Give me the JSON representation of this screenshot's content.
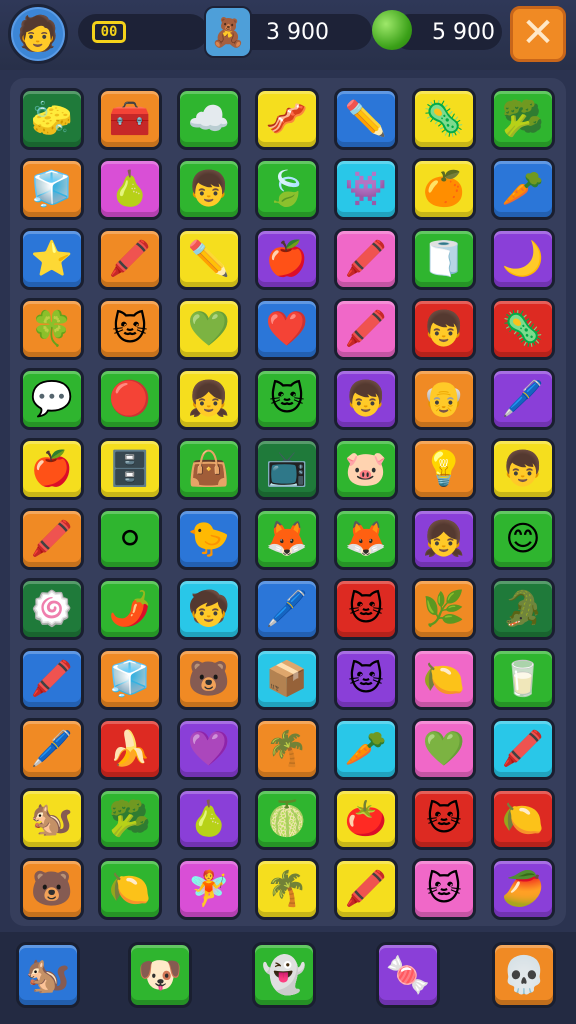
{
  "hud": {
    "avatar_icon": "player-avatar-boy",
    "level_text": "00",
    "coins": "3 900",
    "gems": "5 900",
    "close_label": "✕"
  },
  "colors": {
    "green": "#2fb52f",
    "orange": "#f08a24",
    "yellow": "#f5de1e",
    "blue": "#2b76d8",
    "pink": "#f068c8",
    "purple": "#8a3fd8",
    "red": "#dd2a22",
    "cyan": "#29c7e8",
    "darkgreen": "#1f7a3a",
    "lime": "#52c234",
    "magenta": "#d94fd6"
  },
  "board": [
    [
      {
        "c": "darkgreen",
        "g": "🧽"
      },
      {
        "c": "orange",
        "g": "🧰"
      },
      {
        "c": "green",
        "g": "☁️"
      },
      {
        "c": "yellow",
        "g": "🥓"
      },
      {
        "c": "blue",
        "g": "✏️"
      },
      {
        "c": "yellow",
        "g": "🦠"
      },
      {
        "c": "green",
        "g": "🥦"
      }
    ],
    [
      {
        "c": "orange",
        "g": "🧊"
      },
      {
        "c": "magenta",
        "g": "🍐"
      },
      {
        "c": "green",
        "g": "👦"
      },
      {
        "c": "green",
        "g": "🍃"
      },
      {
        "c": "cyan",
        "g": "👾"
      },
      {
        "c": "yellow",
        "g": "🍊"
      },
      {
        "c": "blue",
        "g": "🥕"
      }
    ],
    [
      {
        "c": "blue",
        "g": "⭐"
      },
      {
        "c": "orange",
        "g": "🖍️"
      },
      {
        "c": "yellow",
        "g": "✏️"
      },
      {
        "c": "purple",
        "g": "🍎"
      },
      {
        "c": "pink",
        "g": "🖍️"
      },
      {
        "c": "green",
        "g": "🧻"
      },
      {
        "c": "purple",
        "g": "🌙"
      }
    ],
    [
      {
        "c": "orange",
        "g": "🍀"
      },
      {
        "c": "orange",
        "g": "🐱"
      },
      {
        "c": "yellow",
        "g": "💚"
      },
      {
        "c": "blue",
        "g": "❤️"
      },
      {
        "c": "pink",
        "g": "🖍️"
      },
      {
        "c": "red",
        "g": "👦"
      },
      {
        "c": "red",
        "g": "🦠"
      }
    ],
    [
      {
        "c": "green",
        "g": "💬"
      },
      {
        "c": "green",
        "g": "🔴"
      },
      {
        "c": "yellow",
        "g": "👧"
      },
      {
        "c": "green",
        "g": "🐱"
      },
      {
        "c": "purple",
        "g": "👦"
      },
      {
        "c": "orange",
        "g": "👴"
      },
      {
        "c": "purple",
        "g": "🖊️"
      }
    ],
    [
      {
        "c": "yellow",
        "g": "🍎"
      },
      {
        "c": "yellow",
        "g": "🗄️"
      },
      {
        "c": "green",
        "g": "👜"
      },
      {
        "c": "darkgreen",
        "g": "📺"
      },
      {
        "c": "green",
        "g": "🐷"
      },
      {
        "c": "orange",
        "g": "💡"
      },
      {
        "c": "yellow",
        "g": "👦"
      }
    ],
    [
      {
        "c": "orange",
        "g": "🖍️"
      },
      {
        "c": "green",
        "g": "⚪"
      },
      {
        "c": "blue",
        "g": "🐤"
      },
      {
        "c": "green",
        "g": "🦊"
      },
      {
        "c": "green",
        "g": "🦊"
      },
      {
        "c": "purple",
        "g": "👧"
      },
      {
        "c": "green",
        "g": "😊"
      }
    ],
    [
      {
        "c": "darkgreen",
        "g": "🍥"
      },
      {
        "c": "green",
        "g": "🌶️"
      },
      {
        "c": "cyan",
        "g": "🧒"
      },
      {
        "c": "blue",
        "g": "🖊️"
      },
      {
        "c": "red",
        "g": "🐱"
      },
      {
        "c": "orange",
        "g": "🌿"
      },
      {
        "c": "darkgreen",
        "g": "🐊"
      }
    ],
    [
      {
        "c": "blue",
        "g": "🖍️"
      },
      {
        "c": "orange",
        "g": "🧊"
      },
      {
        "c": "orange",
        "g": "🐻"
      },
      {
        "c": "cyan",
        "g": "📦"
      },
      {
        "c": "purple",
        "g": "🐱"
      },
      {
        "c": "pink",
        "g": "🍋"
      },
      {
        "c": "green",
        "g": "🥛"
      }
    ],
    [
      {
        "c": "orange",
        "g": "🖊️"
      },
      {
        "c": "red",
        "g": "🍌"
      },
      {
        "c": "purple",
        "g": "💜"
      },
      {
        "c": "orange",
        "g": "🌴"
      },
      {
        "c": "cyan",
        "g": "🥕"
      },
      {
        "c": "pink",
        "g": "💚"
      },
      {
        "c": "cyan",
        "g": "🖍️"
      }
    ],
    [
      {
        "c": "yellow",
        "g": "🐿️"
      },
      {
        "c": "green",
        "g": "🥦"
      },
      {
        "c": "purple",
        "g": "🍐"
      },
      {
        "c": "green",
        "g": "🍈"
      },
      {
        "c": "yellow",
        "g": "🍅"
      },
      {
        "c": "red",
        "g": "🐱"
      },
      {
        "c": "red",
        "g": "🍋"
      }
    ],
    [
      {
        "c": "orange",
        "g": "🐻"
      },
      {
        "c": "green",
        "g": "🍋"
      },
      {
        "c": "magenta",
        "g": "🧚"
      },
      {
        "c": "yellow",
        "g": "🌴"
      },
      {
        "c": "yellow",
        "g": "🖍️"
      },
      {
        "c": "pink",
        "g": "🐱"
      },
      {
        "c": "purple",
        "g": "🥭"
      }
    ]
  ],
  "powerups": [
    {
      "c": "blue",
      "g": "🐿️"
    },
    {
      "c": "green",
      "g": "🐶"
    },
    {
      "c": "green",
      "g": "👻"
    },
    {
      "c": "purple",
      "g": "🍬"
    },
    {
      "c": "orange",
      "g": "💀"
    }
  ]
}
